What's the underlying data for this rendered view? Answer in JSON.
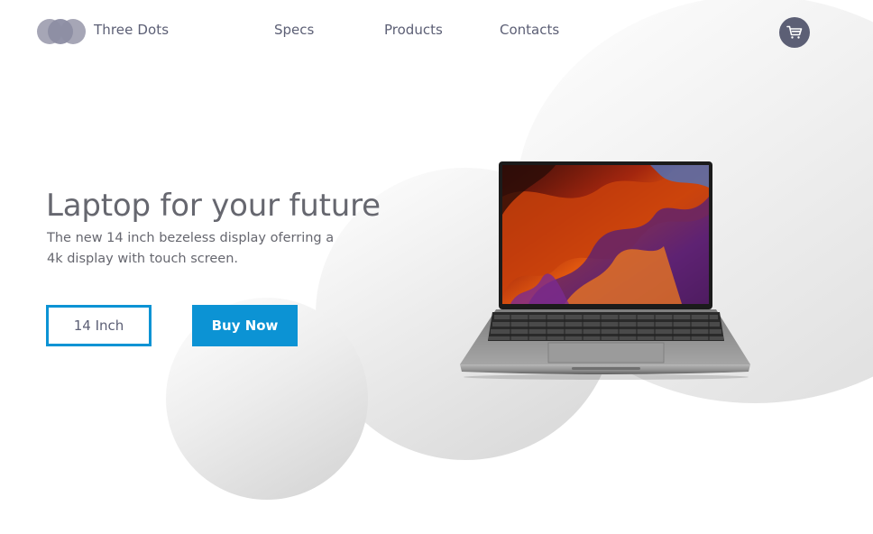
{
  "header": {
    "brand": "Three Dots",
    "nav": [
      "Specs",
      "Products",
      "Contacts"
    ],
    "cart_icon": "cart-icon"
  },
  "hero": {
    "headline": "Laptop for your future",
    "subtext_line1": "The new 14 inch bezeless display oferring a",
    "subtext_line2": "4k display with touch screen.",
    "option_button": "14 Inch",
    "buy_button": "Buy Now"
  },
  "colors": {
    "accent": "#0c93d4",
    "text": "#5c5f75",
    "logo": "#a6a6b6"
  }
}
